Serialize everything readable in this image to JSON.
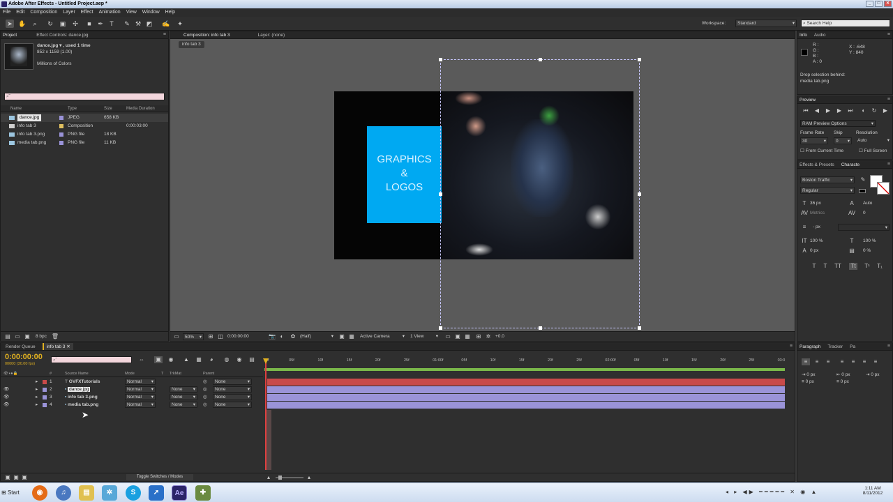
{
  "window": {
    "title": "Adobe After Effects - Untitled Project.aep *",
    "min": "_",
    "max": "□",
    "close": "✕"
  },
  "menu": [
    "File",
    "Edit",
    "Composition",
    "Layer",
    "Effect",
    "Animation",
    "View",
    "Window",
    "Help"
  ],
  "toolbar": {
    "workspace_label": "Workspace:",
    "workspace_value": "Standard",
    "search_placeholder": "Search Help"
  },
  "project": {
    "tab": "Project",
    "effect_tab": "Effect Controls: dance.jpg",
    "item": {
      "name": "dance.jpg ▾ , used 1 time",
      "dims": "852 x 1159 (1.00)",
      "colors": "Millions of Colors"
    },
    "search": "⌕˜",
    "columns": {
      "name": "Name",
      "type": "Type",
      "size": "Size",
      "duration": "Media Duration"
    },
    "rows": [
      {
        "name": "dance.jpg",
        "type": "JPEG",
        "size": "658 KB",
        "duration": ""
      },
      {
        "name": "info tab 3",
        "type": "Composition",
        "size": "",
        "duration": "0:00:03:00"
      },
      {
        "name": "info tab 3.png",
        "type": "PNG file",
        "size": "18 KB",
        "duration": ""
      },
      {
        "name": "media tab.png",
        "type": "PNG file",
        "size": "11 KB",
        "duration": ""
      }
    ],
    "bpc": "8 bpc"
  },
  "comp": {
    "tab": "Composition: info tab 3",
    "layer_tab": "Layer: (none)",
    "breadcrumb": "info tab 3",
    "overlay_text": [
      "GRAPHICS",
      "&",
      "LOGOS"
    ],
    "zoom": "50%",
    "timecode": "0:00:00:00",
    "resolution": "(Half)",
    "camera": "Active Camera",
    "view": "1 View",
    "exposure": "+0.0"
  },
  "info": {
    "tab": "Info",
    "audio_tab": "Audio",
    "r": "R :",
    "g": "G :",
    "b": "B :",
    "a": "A : 0",
    "x": "X : -648",
    "y": "Y : 840",
    "drop_line1": "Drop selection behind:",
    "drop_line2": "media tab.png"
  },
  "preview": {
    "tab": "Preview",
    "ram_options": "RAM Preview Options",
    "frame_rate_label": "Frame Rate",
    "skip_label": "Skip",
    "resolution_label": "Resolution",
    "frame_rate": "30",
    "skip": "0",
    "resolution": "Auto",
    "from_current": "From Current Time",
    "full_screen": "Full Screen"
  },
  "character": {
    "tab_effects": "Effects & Presets",
    "tab_char": "Characte",
    "font": "Boston Traffic",
    "style": "Regular",
    "size": "36 px",
    "leading": "Auto",
    "kerning": "Metrics",
    "tracking": "0",
    "stroke": "- px",
    "vscale": "100 %",
    "hscale": "100 %",
    "baseline": "0 px",
    "tsume": "0 %"
  },
  "paragraph": {
    "tab": "Paragraph",
    "tracker_tab": "Tracker",
    "pa_tab": "Pa",
    "v1": "0 px",
    "v2": "0 px",
    "v3": "0 px",
    "v4": "0 px",
    "v5": "0 px"
  },
  "timeline": {
    "render_tab": "Render Queue",
    "comp_tab": "info tab 3",
    "timecode": "0:00:00:00",
    "fps": "00000 (30.00 fps)",
    "columns": {
      "src": "Source Name",
      "mode": "Mode",
      "t": "T",
      "trkmat": "TrkMat",
      "parent": "Parent"
    },
    "layers": [
      {
        "num": "1",
        "name": "GVFXTutorials",
        "mode": "Normal",
        "trkmat": "",
        "parent": "None",
        "color": "#c84a4a"
      },
      {
        "num": "2",
        "name": "dance.jpg",
        "mode": "Normal",
        "trkmat": "None",
        "parent": "None",
        "color": "#9a93d8"
      },
      {
        "num": "3",
        "name": "info tab 3.png",
        "mode": "Normal",
        "trkmat": "None",
        "parent": "None",
        "color": "#9a93d8"
      },
      {
        "num": "4",
        "name": "media tab.png",
        "mode": "Normal",
        "trkmat": "None",
        "parent": "None",
        "color": "#9a93d8"
      }
    ],
    "ruler": [
      "0f",
      "05f",
      "10f",
      "15f",
      "20f",
      "25f",
      "01:00f",
      "05f",
      "10f",
      "15f",
      "20f",
      "25f",
      "02:00f",
      "05f",
      "10f",
      "15f",
      "20f",
      "25f",
      "03:0"
    ],
    "toggle": "Toggle Switches / Modes"
  },
  "taskbar": {
    "start": "Start",
    "time": "1:11 AM",
    "date": "8/11/2012"
  },
  "colors": {
    "panel": "#2f2f2f",
    "accent_yellow": "#e0b020",
    "blue_box": "#00a9f2",
    "layer_red": "#c84a4a",
    "layer_purple": "#9a93d8"
  }
}
